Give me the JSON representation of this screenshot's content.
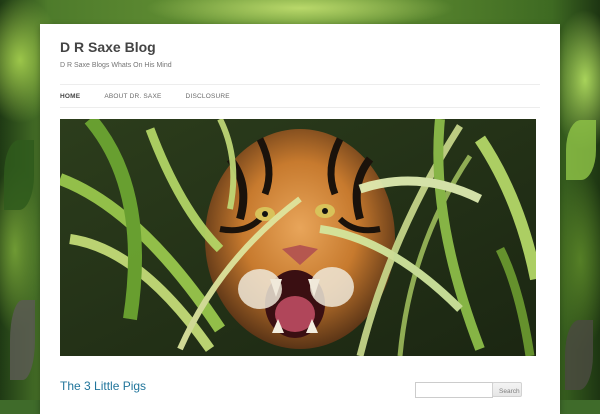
{
  "site": {
    "title": "D R Saxe Blog",
    "description": "D R Saxe Blogs Whats On His Mind"
  },
  "nav": {
    "items": [
      {
        "label": "HOME",
        "active": true
      },
      {
        "label": "ABOUT DR. SAXE",
        "active": false
      },
      {
        "label": "DISCLOSURE",
        "active": false
      }
    ]
  },
  "hero": {
    "image": "tiger-in-bamboo-header-image"
  },
  "post": {
    "title": "The 3 Little Pigs"
  },
  "search": {
    "value": "",
    "button_label": "Search"
  },
  "colors": {
    "link": "#21759b",
    "page_background": "#ffffff"
  }
}
